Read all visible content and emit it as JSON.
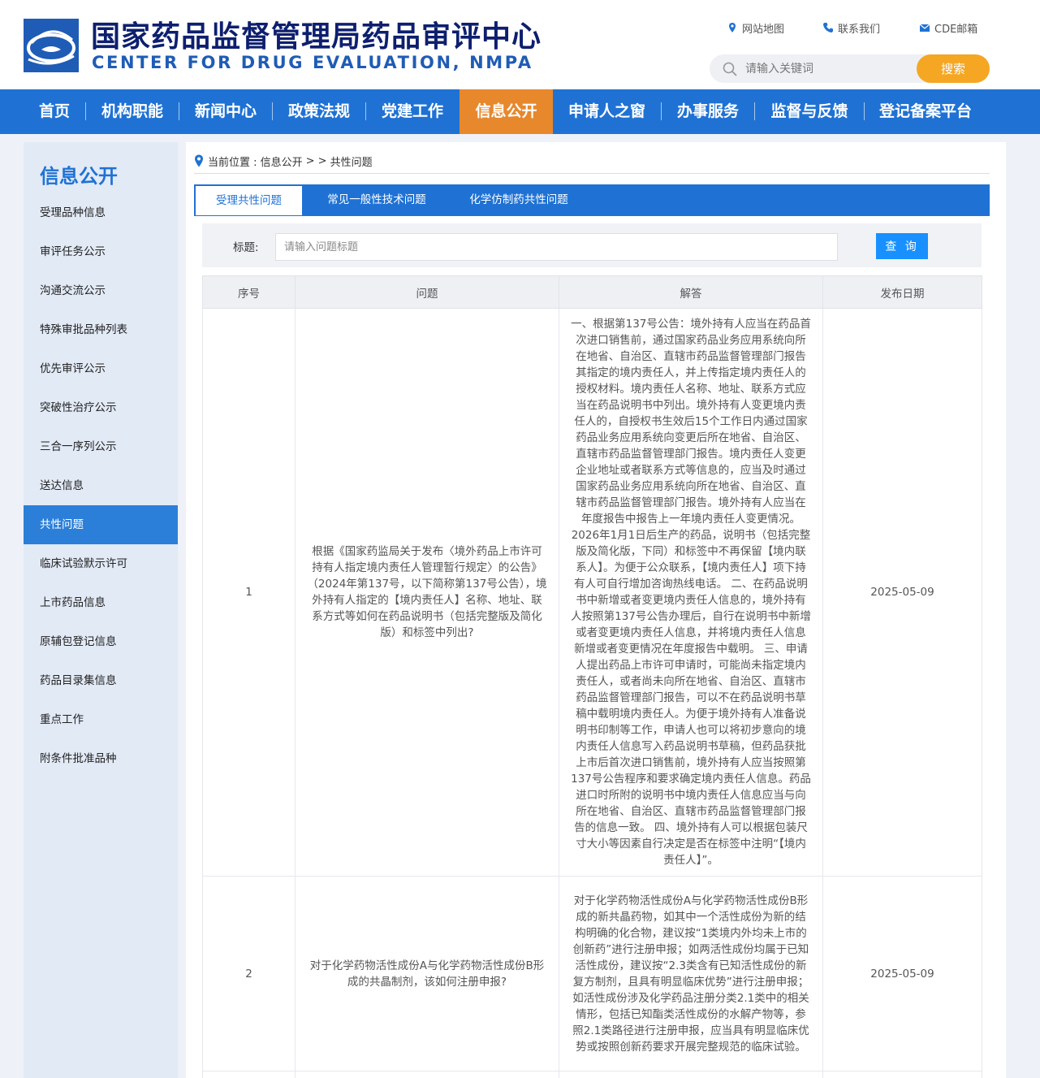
{
  "header": {
    "title": "国家药品监督管理局药品审评中心",
    "subtitle": "CENTER FOR DRUG EVALUATION, NMPA",
    "logo_icon": "cde-logo-icon",
    "links": [
      {
        "label": "网站地图",
        "icon": "location-pin-icon"
      },
      {
        "label": "联系我们",
        "icon": "phone-icon"
      },
      {
        "label": "CDE邮箱",
        "icon": "mail-icon"
      }
    ],
    "search_placeholder": "请输入关键词",
    "search_button": "搜索"
  },
  "nav": {
    "items": [
      "首页",
      "机构职能",
      "新闻中心",
      "政策法规",
      "党建工作",
      "信息公开",
      "申请人之窗",
      "办事服务",
      "监督与反馈",
      "登记备案平台"
    ],
    "active": "信息公开"
  },
  "sidebar": {
    "title": "信息公开",
    "items": [
      "受理品种信息",
      "审评任务公示",
      "沟通交流公示",
      "特殊审批品种列表",
      "优先审评公示",
      "突破性治疗公示",
      "三合一序列公示",
      "送达信息",
      "共性问题",
      "临床试验默示许可",
      "上市药品信息",
      "原辅包登记信息",
      "药品目录集信息",
      "重点工作",
      "附条件批准品种"
    ],
    "active": "共性问题"
  },
  "breadcrumb": {
    "prefix": "当前位置 : 信息公开",
    "sep": "> >",
    "current": "共性问题"
  },
  "tabs": [
    "受理共性问题",
    "常见一般性技术问题",
    "化学仿制药共性问题"
  ],
  "filter": {
    "label": "标题:",
    "placeholder": "请输入问题标题",
    "button": "查 询"
  },
  "table": {
    "headers": [
      "序号",
      "问题",
      "解答",
      "发布日期"
    ],
    "rows": [
      {
        "no": "1",
        "question": "根据《国家药监局关于发布〈境外药品上市许可持有人指定境内责任人管理暂行规定〉的公告》（2024年第137号，以下简称第137号公告），境外持有人指定的【境内责任人】名称、地址、联系方式等如何在药品说明书（包括完整版及简化版）和标签中列出?",
        "answer": "一、根据第137号公告：境外持有人应当在药品首次进口销售前，通过国家药品业务应用系统向所在地省、自治区、直辖市药品监督管理部门报告其指定的境内责任人，并上传指定境内责任人的授权材料。境内责任人名称、地址、联系方式应当在药品说明书中列出。境外持有人变更境内责任人的，自授权书生效后15个工作日内通过国家药品业务应用系统向变更后所在地省、自治区、直辖市药品监督管理部门报告。境内责任人变更企业地址或者联系方式等信息的，应当及时通过国家药品业务应用系统向所在地省、自治区、直辖市药品监督管理部门报告。境外持有人应当在年度报告中报告上一年境内责任人变更情况。 2026年1月1日后生产的药品，说明书（包括完整版及简化版，下同）和标签中不再保留【境内联系人】。为便于公众联系，【境内责任人】项下持有人可自行增加咨询热线电话。 二、在药品说明书中新增或者变更境内责任人信息的，境外持有人按照第137号公告办理后，自行在说明书中新增或者变更境内责任人信息，并将境内责任人信息新增或者变更情况在年度报告中载明。 三、申请人提出药品上市许可申请时，可能尚未指定境内责任人，或者尚未向所在地省、自治区、直辖市药品监督管理部门报告，可以不在药品说明书草稿中载明境内责任人。为便于境外持有人准备说明书印制等工作，申请人也可以将初步意向的境内责任人信息写入药品说明书草稿，但药品获批上市后首次进口销售前，境外持有人应当按照第137号公告程序和要求确定境内责任人信息。药品进口时所附的说明书中境内责任人信息应当与向所在地省、自治区、直辖市药品监督管理部门报告的信息一致。 四、境外持有人可以根据包装尺寸大小等因素自行决定是否在标签中注明“【境内责任人】”。",
        "date": "2025-05-09"
      },
      {
        "no": "2",
        "question": "对于化学药物活性成份A与化学药物活性成份B形成的共晶制剂，该如何注册申报?",
        "answer": "对于化学药物活性成份A与化学药物活性成份B形成的新共晶药物，如其中一个活性成份为新的结构明确的化合物，建议按“1类境内外均未上市的创新药”进行注册申报；如两活性成份均属于已知活性成份，建议按“2.3类含有已知活性成份的新复方制剂，且具有明显临床优势”进行注册申报；如活性成份涉及化学药品注册分类2.1类中的相关情形，包括已知酯类活性成份的水解产物等，参照2.1类路径进行注册申报，应当具有明显临床优势或按照创新药要求开展完整规范的临床试验。",
        "date": "2025-05-09"
      }
    ]
  },
  "colors": {
    "primary": "#1f72d4",
    "accent": "#e8882d",
    "title": "#0d1f6e",
    "search_button": "#f5a623"
  }
}
